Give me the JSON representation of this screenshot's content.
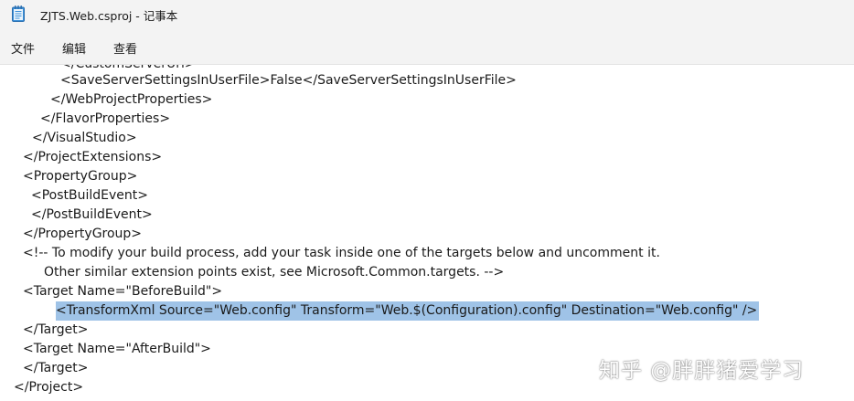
{
  "window": {
    "title": "ZJTS.Web.csproj - 记事本",
    "icon": "notepad-icon"
  },
  "menu": {
    "items": [
      "文件",
      "编辑",
      "查看"
    ]
  },
  "editor": {
    "lines": [
      {
        "text": "</CustomServerUrl>",
        "selected": false
      },
      {
        "text": "<SaveServerSettingsInUserFile>False</SaveServerSettingsInUserFile>",
        "selected": false
      },
      {
        "text": "</WebProjectProperties>",
        "selected": false
      },
      {
        "text": "</FlavorProperties>",
        "selected": false
      },
      {
        "text": "</VisualStudio>",
        "selected": false
      },
      {
        "text": "</ProjectExtensions>",
        "selected": false
      },
      {
        "text": "<PropertyGroup>",
        "selected": false
      },
      {
        "text": "<PostBuildEvent>",
        "selected": false
      },
      {
        "text": "</PostBuildEvent>",
        "selected": false
      },
      {
        "text": "</PropertyGroup>",
        "selected": false
      },
      {
        "text": "<!-- To modify your build process, add your task inside one of the targets below and uncomment it.",
        "selected": false
      },
      {
        "text": "Other similar extension points exist, see Microsoft.Common.targets. -->",
        "selected": false
      },
      {
        "text": "<Target Name=\"BeforeBuild\">",
        "selected": false
      },
      {
        "text": "<TransformXml Source=\"Web.config\" Transform=\"Web.$(Configuration).config\" Destination=\"Web.config\" />",
        "selected": true
      },
      {
        "text": "</Target>",
        "selected": false
      },
      {
        "text": "<Target Name=\"AfterBuild\">",
        "selected": false
      },
      {
        "text": "</Target>",
        "selected": false
      },
      {
        "text": "</Project>",
        "selected": false
      }
    ]
  },
  "watermark": {
    "text": "知乎 @胖胖猪爱学习"
  },
  "colors": {
    "chrome": "#f3f3f3",
    "selection": "#9fc3e7",
    "text": "#1a1a1a"
  }
}
